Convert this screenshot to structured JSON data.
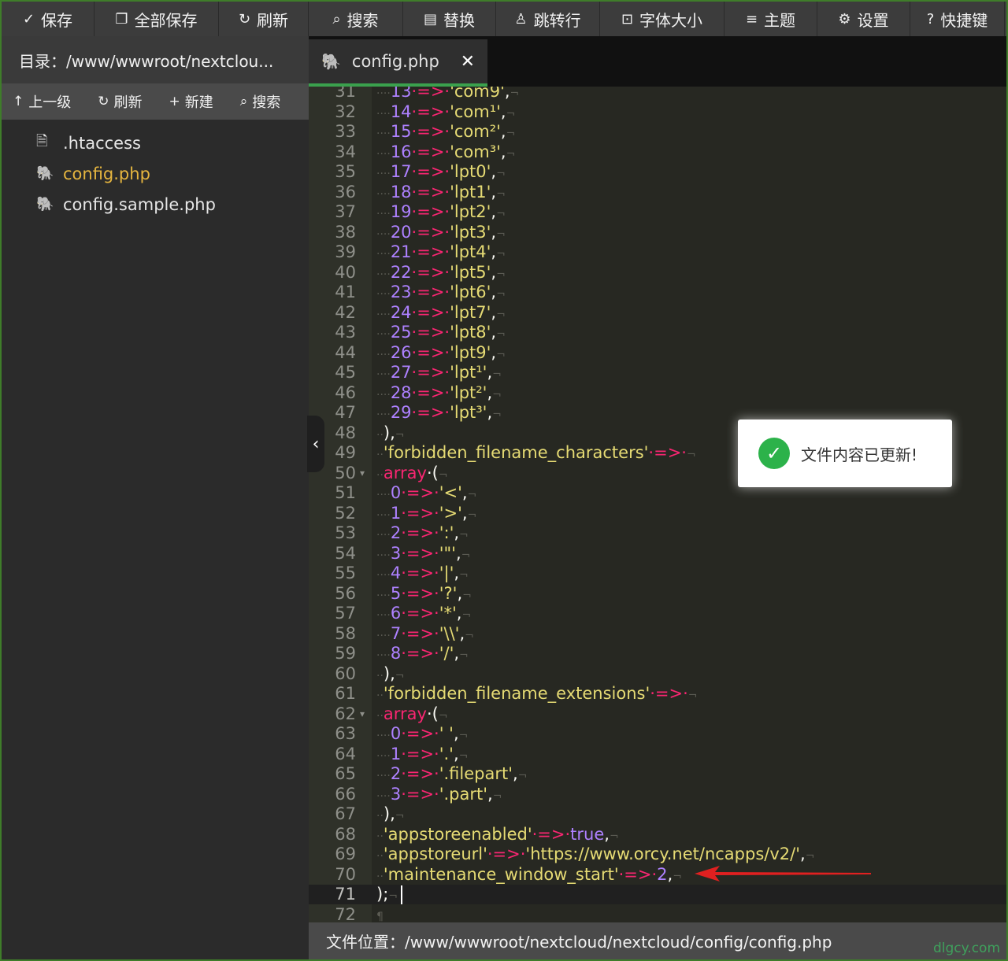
{
  "toolbar": {
    "items": [
      {
        "icon": "✓",
        "label": "保存"
      },
      {
        "icon": "❐",
        "label": "全部保存"
      },
      {
        "icon": "↻",
        "label": "刷新"
      },
      {
        "icon": "⌕",
        "label": "搜索"
      },
      {
        "icon": "▤",
        "label": "替换"
      },
      {
        "icon": "♙",
        "label": "跳转行"
      },
      {
        "icon": "⊡",
        "label": "字体大小"
      },
      {
        "icon": "≡",
        "label": "主题"
      },
      {
        "icon": "⚙",
        "label": "设置"
      },
      {
        "icon": "?",
        "label": "快捷键"
      }
    ]
  },
  "sidebar": {
    "directory": "目录：/www/wwwroot/nextclou...",
    "actions": [
      {
        "icon": "↑",
        "label": "上一级"
      },
      {
        "icon": "↻",
        "label": "刷新"
      },
      {
        "icon": "+",
        "label": "新建"
      },
      {
        "icon": "⌕",
        "label": "搜索"
      }
    ],
    "files": [
      {
        "name": ".htaccess",
        "type": "text"
      },
      {
        "name": "config.php",
        "type": "php"
      },
      {
        "name": "config.sample.php",
        "type": "php"
      }
    ]
  },
  "tab": {
    "name": "config.php",
    "close": "✕"
  },
  "toast": {
    "message": "文件内容已更新!"
  },
  "status": {
    "path": "文件位置：/www/wwwroot/nextcloud/nextcloud/config/config.php"
  },
  "watermark": "dlgcy.com",
  "editor": {
    "lines": [
      {
        "n": "31",
        "k": "map",
        "key": "13",
        "val": "'com9'"
      },
      {
        "n": "32",
        "k": "map",
        "key": "14",
        "val": "'com¹'"
      },
      {
        "n": "33",
        "k": "map",
        "key": "15",
        "val": "'com²'"
      },
      {
        "n": "34",
        "k": "map",
        "key": "16",
        "val": "'com³'"
      },
      {
        "n": "35",
        "k": "map",
        "key": "17",
        "val": "'lpt0'"
      },
      {
        "n": "36",
        "k": "map",
        "key": "18",
        "val": "'lpt1'"
      },
      {
        "n": "37",
        "k": "map",
        "key": "19",
        "val": "'lpt2'"
      },
      {
        "n": "38",
        "k": "map",
        "key": "20",
        "val": "'lpt3'"
      },
      {
        "n": "39",
        "k": "map",
        "key": "21",
        "val": "'lpt4'"
      },
      {
        "n": "40",
        "k": "map",
        "key": "22",
        "val": "'lpt5'"
      },
      {
        "n": "41",
        "k": "map",
        "key": "23",
        "val": "'lpt6'"
      },
      {
        "n": "42",
        "k": "map",
        "key": "24",
        "val": "'lpt7'"
      },
      {
        "n": "43",
        "k": "map",
        "key": "25",
        "val": "'lpt8'"
      },
      {
        "n": "44",
        "k": "map",
        "key": "26",
        "val": "'lpt9'"
      },
      {
        "n": "45",
        "k": "map",
        "key": "27",
        "val": "'lpt¹'"
      },
      {
        "n": "46",
        "k": "map",
        "key": "28",
        "val": "'lpt²'"
      },
      {
        "n": "47",
        "k": "map",
        "key": "29",
        "val": "'lpt³'"
      },
      {
        "n": "48",
        "k": "close"
      },
      {
        "n": "49",
        "k": "skey",
        "key": "'forbidden_filename_characters'"
      },
      {
        "n": "50",
        "k": "array",
        "fold": true
      },
      {
        "n": "51",
        "k": "map",
        "key": "0",
        "val": "'<'"
      },
      {
        "n": "52",
        "k": "map",
        "key": "1",
        "val": "'>'"
      },
      {
        "n": "53",
        "k": "map",
        "key": "2",
        "val": "':'"
      },
      {
        "n": "54",
        "k": "map",
        "key": "3",
        "val": "'\"'"
      },
      {
        "n": "55",
        "k": "map",
        "key": "4",
        "val": "'|'"
      },
      {
        "n": "56",
        "k": "map",
        "key": "5",
        "val": "'?'"
      },
      {
        "n": "57",
        "k": "map",
        "key": "6",
        "val": "'*'"
      },
      {
        "n": "58",
        "k": "map",
        "key": "7",
        "val": "'\\\\'"
      },
      {
        "n": "59",
        "k": "map",
        "key": "8",
        "val": "'/'"
      },
      {
        "n": "60",
        "k": "close"
      },
      {
        "n": "61",
        "k": "skey",
        "key": "'forbidden_filename_extensions'"
      },
      {
        "n": "62",
        "k": "array",
        "fold": true
      },
      {
        "n": "63",
        "k": "map",
        "key": "0",
        "val": "' '"
      },
      {
        "n": "64",
        "k": "map",
        "key": "1",
        "val": "'.'"
      },
      {
        "n": "65",
        "k": "map",
        "key": "2",
        "val": "'.filepart'"
      },
      {
        "n": "66",
        "k": "map",
        "key": "3",
        "val": "'.part'"
      },
      {
        "n": "67",
        "k": "close"
      },
      {
        "n": "68",
        "k": "kv",
        "key": "'appstoreenabled'",
        "val": "true",
        "vt": "bool"
      },
      {
        "n": "69",
        "k": "kv",
        "key": "'appstoreurl'",
        "val": "'https://www.orcy.net/ncapps/v2/'",
        "vt": "str"
      },
      {
        "n": "70",
        "k": "kv",
        "key": "'maintenance_window_start'",
        "val": "2",
        "vt": "num"
      },
      {
        "n": "71",
        "k": "end",
        "cur": true
      },
      {
        "n": "72",
        "k": "empty"
      }
    ]
  }
}
